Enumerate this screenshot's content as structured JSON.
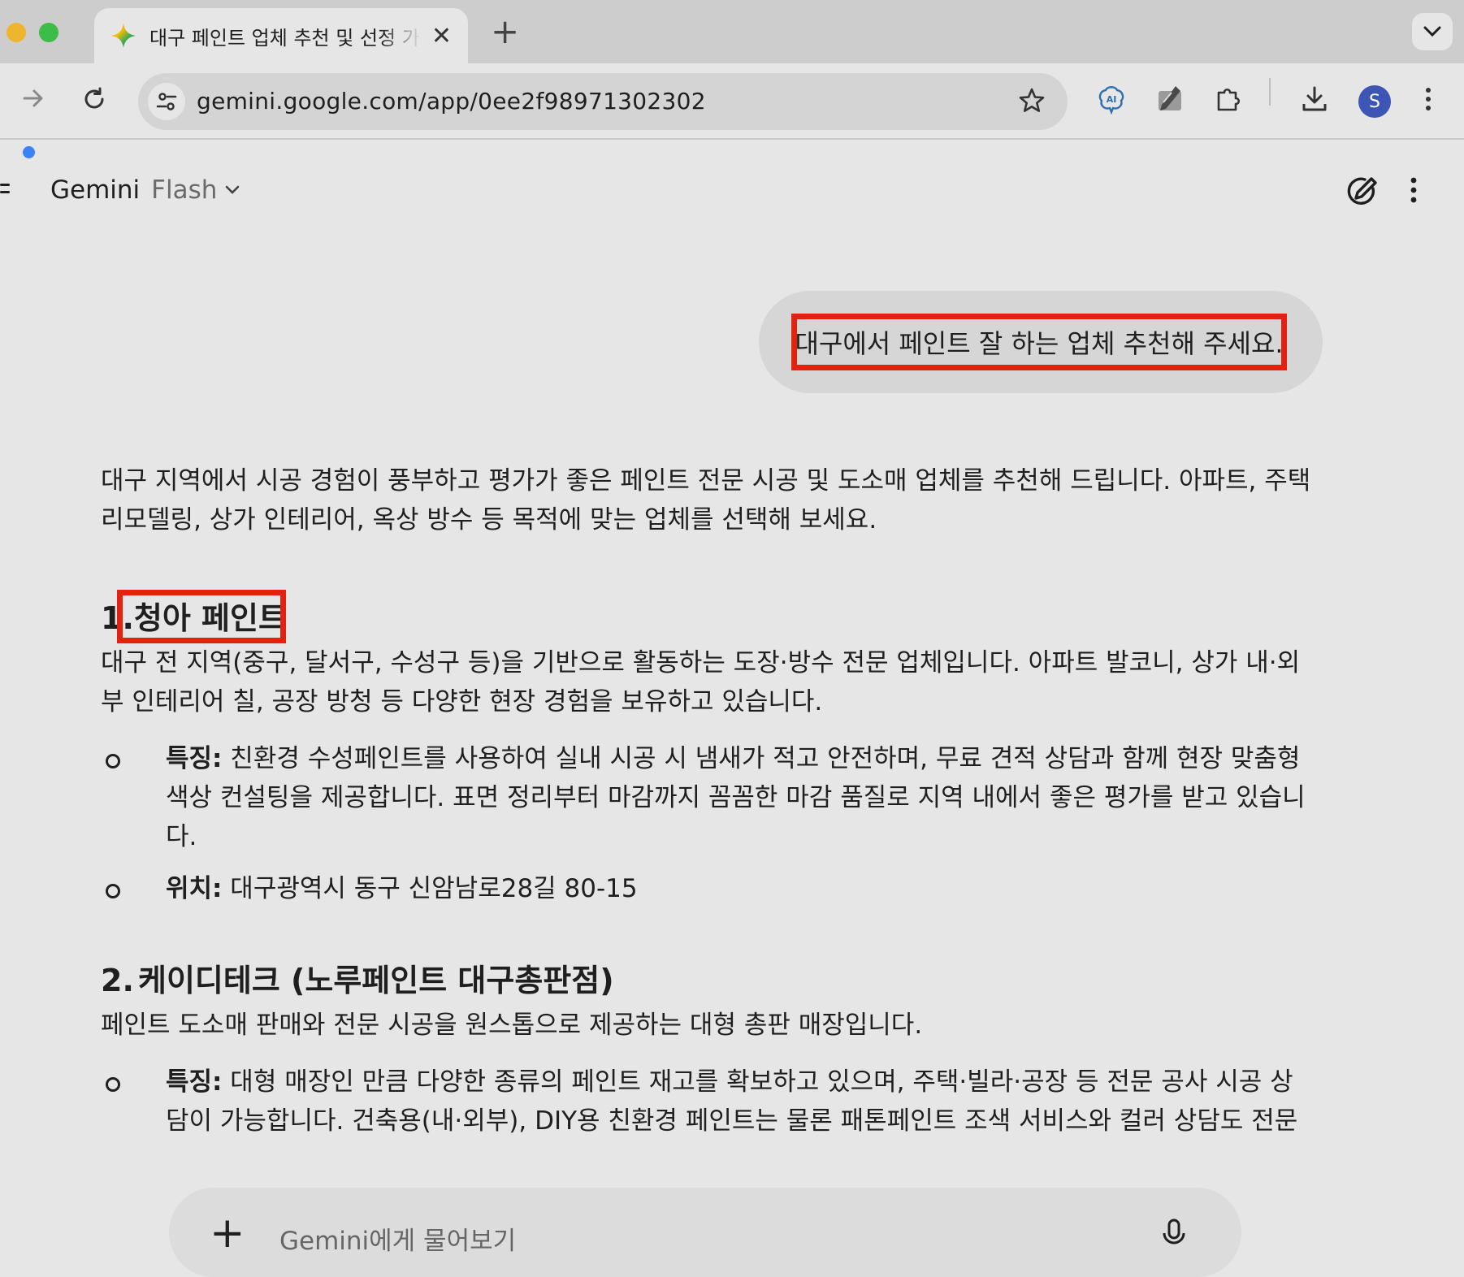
{
  "browser": {
    "tab_title": "대구 페인트 업체 추천 및 선정 가이드",
    "url": "gemini.google.com/app/0ee2f98971302302",
    "profile_initial": "S",
    "accent": "#3d55b5"
  },
  "app": {
    "name": "Gemini",
    "model": "Flash",
    "input_placeholder": "Gemini에게 물어보기"
  },
  "chat": {
    "user_message": "대구에서 페인트 잘 하는 업체 추천해 주세요.",
    "intro": "대구 지역에서 시공 경험이 풍부하고 평가가 좋은 페인트 전문 시공 및 도소매 업체를 추천해 드립니다. 아파트, 주택 리모델링, 상가 인테리어, 옥상 방수 등 목적에 맞는 업체를 선택해 보세요.",
    "items": [
      {
        "number": "1.",
        "title": "청아 페인트",
        "description": "대구 전 지역(중구, 달서구, 수성구 등)을 기반으로 활동하는 도장·방수 전문 업체입니다. 아파트 발코니, 상가 내·외부 인테리어 칠, 공장 방청 등 다양한 현장 경험을 보유하고 있습니다.",
        "bullets": [
          {
            "label": "특징:",
            "text": "친환경 수성페인트를 사용하여 실내 시공 시 냄새가 적고 안전하며, 무료 견적 상담과 함께 현장 맞춤형 색상 컨설팅을 제공합니다. 표면 정리부터 마감까지 꼼꼼한 마감 품질로 지역 내에서 좋은 평가를 받고 있습니다."
          },
          {
            "label": "위치:",
            "text": "대구광역시 동구 신암남로28길 80-15"
          }
        ]
      },
      {
        "number": "2.",
        "title": "케이디테크 (노루페인트 대구총판점)",
        "description": "페인트 도소매 판매와 전문 시공을 원스톱으로 제공하는 대형 총판 매장입니다.",
        "bullets": [
          {
            "label": "특징:",
            "text": "대형 매장인 만큼 다양한 종류의 페인트 재고를 확보하고 있으며, 주택·빌라·공장 등 전문 공사 시공 상담이 가능합니다. 건축용(내·외부), DIY용 친환경 페인트는 물론 패톤페인트 조색 서비스와 컬러 상담도 전문"
          }
        ]
      }
    ]
  }
}
